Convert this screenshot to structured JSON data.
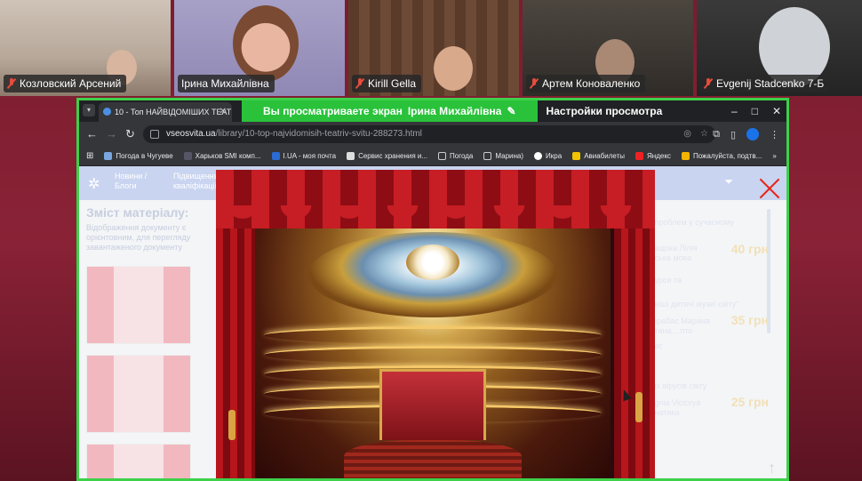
{
  "participants": [
    {
      "name": "Козловский Арсений",
      "muted": true
    },
    {
      "name": "Ірина Михайлівна",
      "muted": false
    },
    {
      "name": "Kirill Gella",
      "muted": true
    },
    {
      "name": "Артем Коноваленко",
      "muted": true
    },
    {
      "name": "Evgenij Stadcenko 7-Б",
      "muted": true
    }
  ],
  "share_banner": {
    "viewing_text": "Вы просматриваете экран",
    "presenter": "Ірина Михайлівна",
    "settings_label": "Настройки просмотра"
  },
  "browser": {
    "tab_title": "10 - Топ НАЙВІДОМІШИХ ТЕАТ",
    "url_domain": "vseosvita.ua",
    "url_path": "/library/10-top-najvidomisih-teatriv-svitu-288273.html",
    "bookmarks": [
      "Погода в Чугуеве",
      "Харьков SMI комп...",
      "I.UA - моя почта",
      "Сервис хранения и...",
      "Погода",
      "Марина)",
      "Икра",
      "Авиабилеты",
      "Яндекс",
      "Пожалуйста, подтв..."
    ],
    "window_controls": {
      "minimize": "–",
      "maximize": "□",
      "close": "✕"
    }
  },
  "page": {
    "nav_items": [
      "Новини / Блоги",
      "Підвищення кваліфікації"
    ],
    "title": "Зміст матеріалу:",
    "subtitle": "Відображення документу є орієнтовним, для перегляду завантаженого документу",
    "courses": [
      {
        "title": "...проблем у сучасному",
        "author": "Нащока Лілія ...ська мова",
        "extra": "...урси та",
        "price": "40 грн"
      },
      {
        "title": "...віші дитячі музеї світу\"",
        "author": "Карабас Марина ...тяна ...пто",
        "extra": "...ас",
        "price": "35 грн"
      },
      {
        "title": "...іх вірусів світу",
        "author": "...gnia Victorya ...натика",
        "extra": "",
        "price": "25 грн"
      }
    ]
  },
  "colors": {
    "active_speaker_border": "#3dd14a",
    "meeting_background": "#7a1d2e",
    "browser_dark": "#202124",
    "curtain_red": "#c71d24",
    "close_x": "#e8241c"
  }
}
